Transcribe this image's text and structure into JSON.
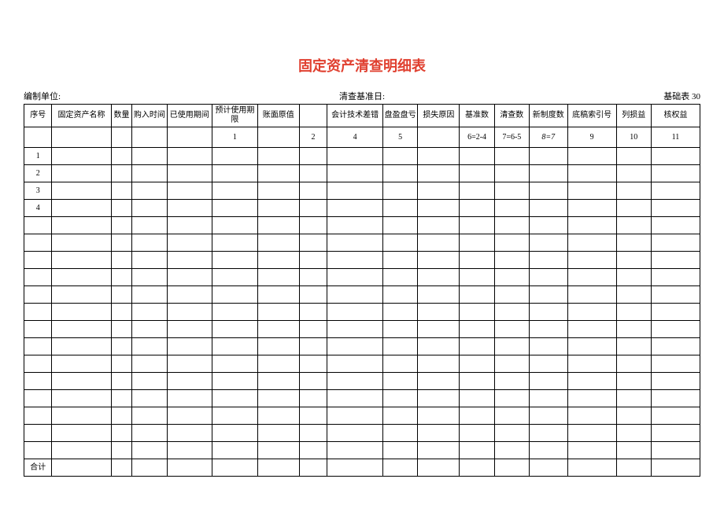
{
  "title": "固定资产清查明细表",
  "meta": {
    "left_label": "编制单位:",
    "center_label": "清查基准日:",
    "right_label": "基础表 30"
  },
  "headers": {
    "col0": "序号",
    "col1": "固定资产名称",
    "col2": "数量",
    "col3": "购入时间",
    "col4": "已使用期间",
    "col5": "预计使用期限",
    "col6": "账面原值",
    "col7_empty": "",
    "col8": "会计技术差错",
    "col9": "盘盈盘亏",
    "col10": "损失原因",
    "col11": "基准数",
    "col12": "清查数",
    "col13": "新制度数",
    "col14": "底稿索引号",
    "col15": "列损益",
    "col16": "核权益"
  },
  "formula_row": {
    "c5": "1",
    "c7": "2",
    "c8": "4",
    "c9": "5",
    "c11": "6=2-4",
    "c12": "7=6-5",
    "c13": "8=7",
    "c14": "9",
    "c15": "10",
    "c16": "11"
  },
  "body_rows": [
    "1",
    "2",
    "3",
    "4",
    "",
    "",
    "",
    "",
    "",
    "",
    "",
    "",
    "",
    "",
    "",
    "",
    "",
    ""
  ],
  "footer_label": "合计"
}
